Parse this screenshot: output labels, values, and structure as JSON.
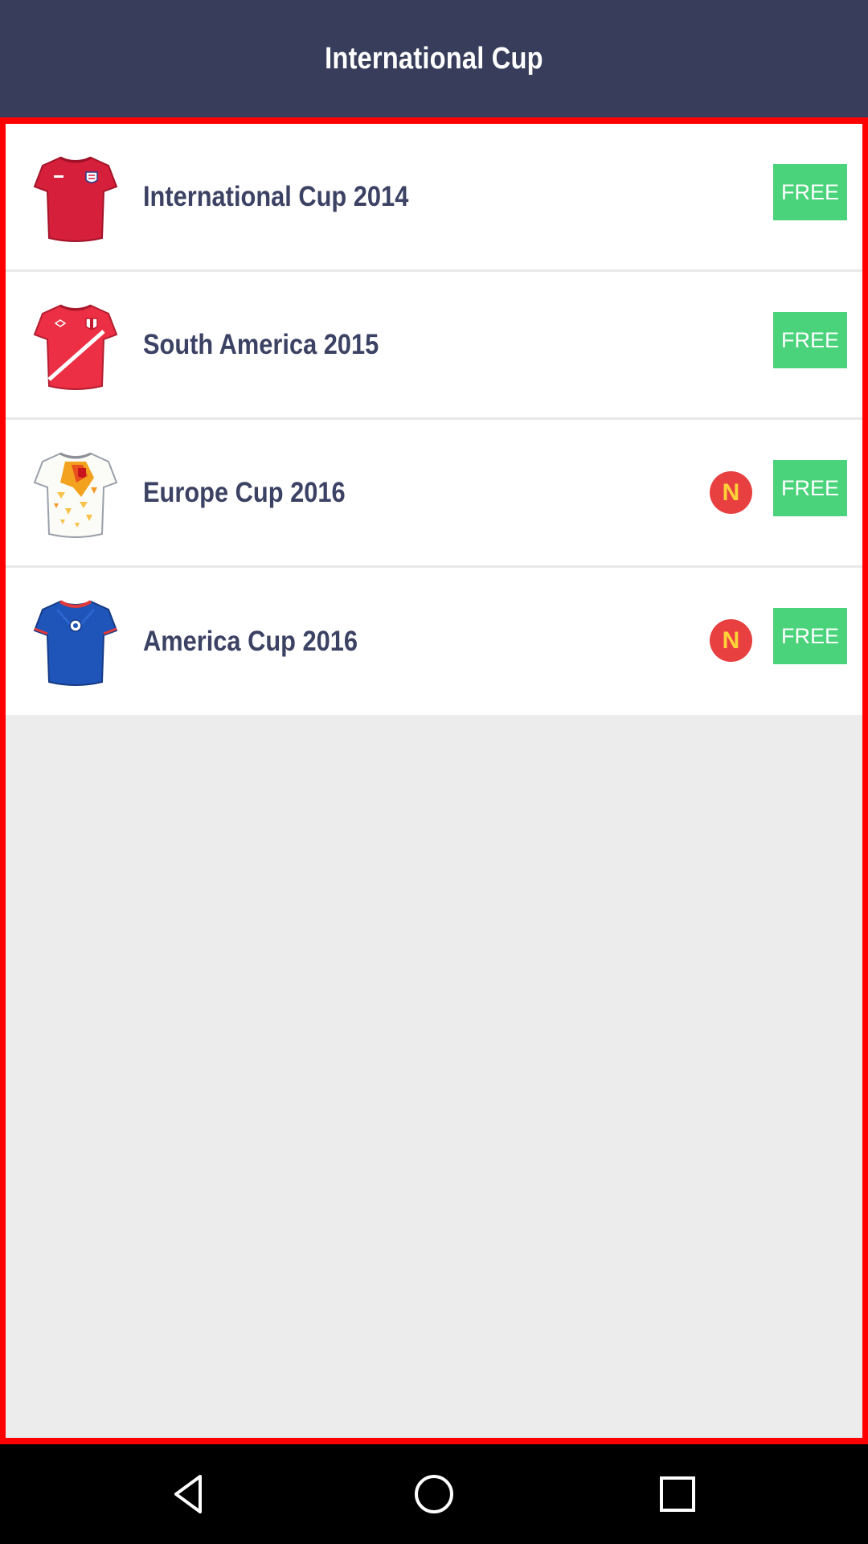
{
  "header": {
    "title": "International Cup"
  },
  "items": [
    {
      "title": "International Cup 2014",
      "jersey": "red-england-jersey-icon",
      "is_new": false,
      "badge": "",
      "price_label": "FREE"
    },
    {
      "title": "South America 2015",
      "jersey": "red-sash-jersey-icon",
      "is_new": false,
      "badge": "",
      "price_label": "FREE"
    },
    {
      "title": "Europe Cup 2016",
      "jersey": "white-orange-jersey-icon",
      "is_new": true,
      "badge": "N",
      "price_label": "FREE"
    },
    {
      "title": "America Cup 2016",
      "jersey": "blue-jersey-icon",
      "is_new": true,
      "badge": "N",
      "price_label": "FREE"
    }
  ],
  "colors": {
    "header_bg": "#373d5a",
    "frame_border": "#ff0000",
    "free_button": "#4ad37a",
    "new_badge": "#e84040",
    "new_badge_text": "#ffd23a",
    "title_text": "#3c4263"
  },
  "navbar": {
    "icons": [
      "back-icon",
      "home-icon",
      "recents-icon"
    ]
  }
}
